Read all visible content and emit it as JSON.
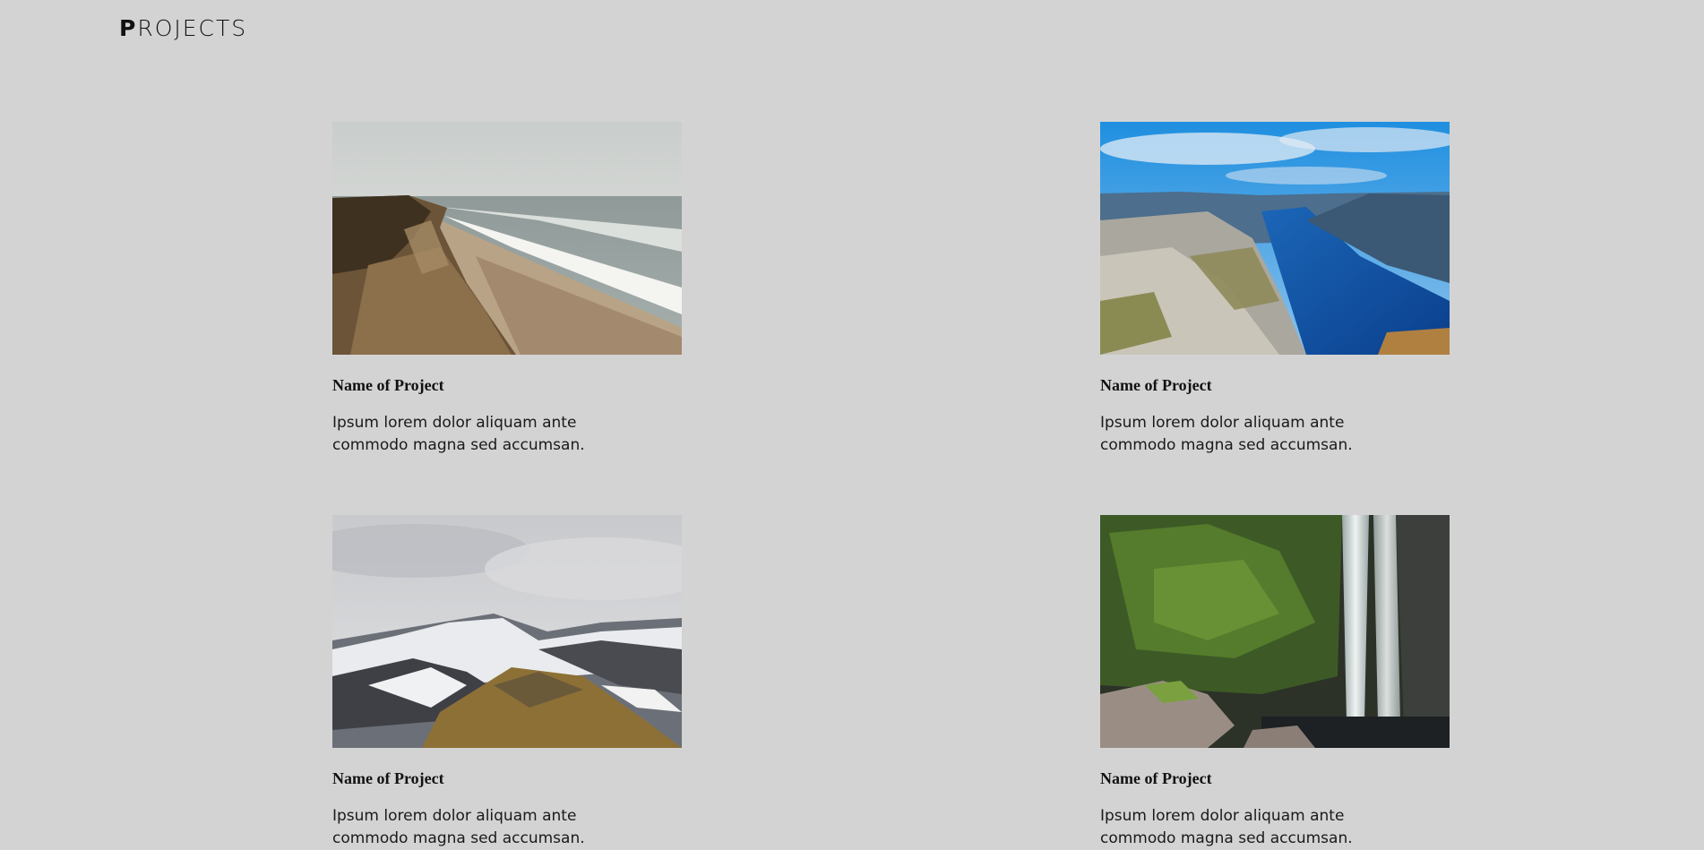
{
  "header": {
    "logo_first": "P",
    "logo_rest": "ROJECTS"
  },
  "projects": [
    {
      "name": "Name of Project",
      "description": "Ipsum lorem dolor aliquam ante commodo magna sed accumsan.",
      "image": "coastal-cliff-beach-photo"
    },
    {
      "name": "Name of Project",
      "description": "Ipsum lorem dolor aliquam ante commodo magna sed accumsan.",
      "image": "fjord-river-cliff-photo"
    },
    {
      "name": "Name of Project",
      "description": "Ipsum lorem dolor aliquam ante commodo magna sed accumsan.",
      "image": "snowy-mountain-ridge-photo"
    },
    {
      "name": "Name of Project",
      "description": "Ipsum lorem dolor aliquam ante commodo magna sed accumsan.",
      "image": "mossy-waterfall-photo"
    }
  ],
  "colors": {
    "background": "#d3d3d3",
    "text": "#111111"
  }
}
